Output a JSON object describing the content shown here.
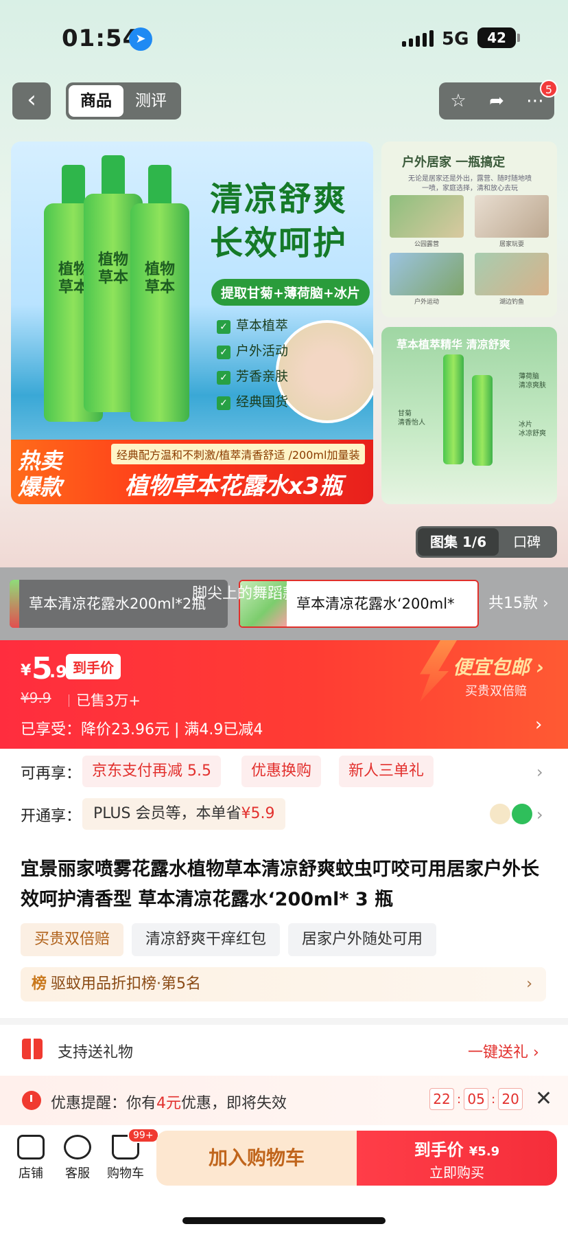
{
  "status_bar": {
    "time": "01:54",
    "network": "5G",
    "battery": "42"
  },
  "nav": {
    "back_label": "‹",
    "tabs": [
      {
        "label": "商品",
        "active": true
      },
      {
        "label": "测评",
        "active": false
      }
    ],
    "actions": [
      "star-icon",
      "share-icon",
      "more-icon"
    ],
    "message_badge": "5"
  },
  "main_image": {
    "headline_1": "清凉舒爽",
    "headline_2": "长效呵护",
    "ingredients": "提取甘菊+薄荷脑+冰片",
    "bottle_label": "植物草本",
    "features": [
      "草本植萃",
      "户外活动",
      "芳香亲肤",
      "经典国货"
    ],
    "hot_sale_1": "热卖",
    "hot_sale_2": "爆款",
    "strip_subtitle": "经典配方温和不刺激/植萃清香舒适 /200ml加量装",
    "strip_title": "植物草本花露水x3瓶"
  },
  "side_image_1": {
    "title": "户外居家  一瓶搞定",
    "desc": "无论是居家还是外出，露营、随时随地喷一喷，家庭选择，清和放心去玩",
    "captions": [
      "公园露营",
      "居家玩耍",
      "户外运动",
      "湖边钓鱼"
    ]
  },
  "side_image_2": {
    "title": "草本植萃精华  清凉舒爽",
    "captions": [
      "甘菊\n清香怡人",
      "薄荷脑\n清凉爽肤",
      "冰片\n冰凉舒爽"
    ]
  },
  "gallery": {
    "album_label": "图集 1/6",
    "review_label": "口碑"
  },
  "variants": {
    "items": [
      {
        "label": "草本清凉花露水200ml*2瓶",
        "selected": false
      },
      {
        "label": "草本清凉花露水‘200ml*",
        "selected": true
      }
    ],
    "count_label": "共15款 ›",
    "overlay": "脚尖上的舞蹈款商"
  },
  "price": {
    "currency": "¥",
    "integer": "5",
    "decimal": ".9",
    "tag": "到手价",
    "original": "¥9.9",
    "sold": "已售3万+",
    "enjoy": "已享受：降价23.96元  |  满4.9已减4",
    "shipping_title": "便宜包邮 ›",
    "shipping_sub": "买贵双倍赔"
  },
  "benefits": {
    "row1_label": "可再享：",
    "row1_chips": [
      "京东支付再减 5.5",
      "优惠换购",
      "新人三单礼"
    ],
    "row2_label": "开通享：",
    "row2_text": "PLUS 会员等，本单省",
    "row2_value": "¥5.9"
  },
  "product": {
    "title": "宜景丽家喷雾花露水植物草本清凉舒爽蚊虫叮咬可用居家户外长效呵护清香型 草本清凉花露水‘200ml* 3 瓶",
    "tags": [
      "买贵双倍赔",
      "清凉舒爽干痒红包",
      "居家户外随处可用"
    ],
    "rank_prefix": "榜",
    "rank_text": "驱蚊用品折扣榜·第5名"
  },
  "gift": {
    "text": "支持送礼物",
    "action": "一键送礼 ›"
  },
  "reminder": {
    "prefix": "优惠提醒：你有",
    "amount": "4元",
    "suffix": "优惠，即将失效",
    "hours": "22",
    "minutes": "05",
    "seconds": "20",
    "close": "✕"
  },
  "bottom_bar": {
    "store": "店铺",
    "service": "客服",
    "cart": "购物车",
    "cart_badge": "99+",
    "add_to_cart": "加入购物车",
    "buy_top": "到手价",
    "buy_price": "¥5.9",
    "buy_bottom": "立即购买"
  },
  "colors": {
    "accent_red": "#f23b3b",
    "green_brand": "#2a9c3b",
    "cart_button_bg": "#fde7d0"
  }
}
